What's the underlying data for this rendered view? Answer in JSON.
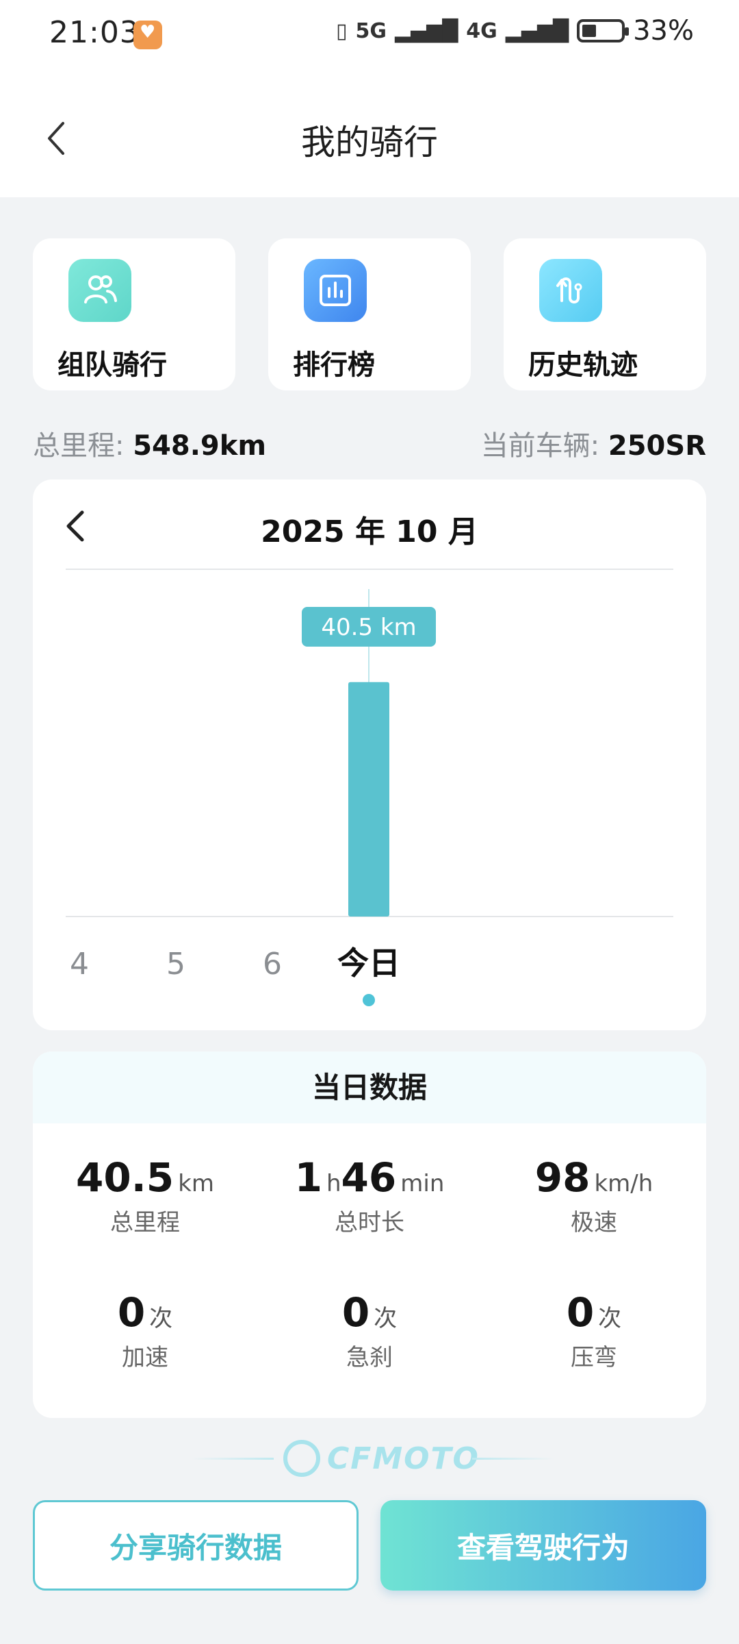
{
  "status_bar": {
    "time": "21:03",
    "network_1": "5G",
    "network_2": "4G",
    "battery": "33%"
  },
  "header": {
    "title": "我的骑行"
  },
  "quick_actions": [
    {
      "label": "组队骑行",
      "icon": "team-icon"
    },
    {
      "label": "排行榜",
      "icon": "ranking-icon"
    },
    {
      "label": "历史轨迹",
      "icon": "track-icon"
    }
  ],
  "totals": {
    "mileage_label": "总里程:",
    "mileage_value": "548.9km",
    "vehicle_label": "当前车辆:",
    "vehicle_value": "250SR"
  },
  "chart": {
    "month_title": "2025 年 10 月",
    "tooltip_value": "40.5",
    "tooltip_unit": "km"
  },
  "chart_data": {
    "type": "bar",
    "categories": [
      "4",
      "5",
      "6",
      "今日"
    ],
    "values": [
      0,
      0,
      0,
      40.5
    ],
    "unit": "km",
    "selected": "今日"
  },
  "day_data": {
    "title": "当日数据",
    "stats": [
      {
        "num": "40.5",
        "unit": "km",
        "label": "总里程"
      },
      {
        "num_h": "1",
        "unit_h": "h",
        "num_m": "46",
        "unit_m": "min",
        "label": "总时长"
      },
      {
        "num": "98",
        "unit": "km/h",
        "label": "极速"
      },
      {
        "num": "0",
        "unit": "次",
        "label": "加速"
      },
      {
        "num": "0",
        "unit": "次",
        "label": "急刹"
      },
      {
        "num": "0",
        "unit": "次",
        "label": "压弯"
      }
    ]
  },
  "brand": {
    "text": "CFMOTO"
  },
  "buttons": {
    "share": "分享骑行数据",
    "view": "查看驾驶行为"
  },
  "colors": {
    "accent": "#4fc3d7",
    "bar": "#5ac2cf",
    "background": "#f1f3f5"
  }
}
